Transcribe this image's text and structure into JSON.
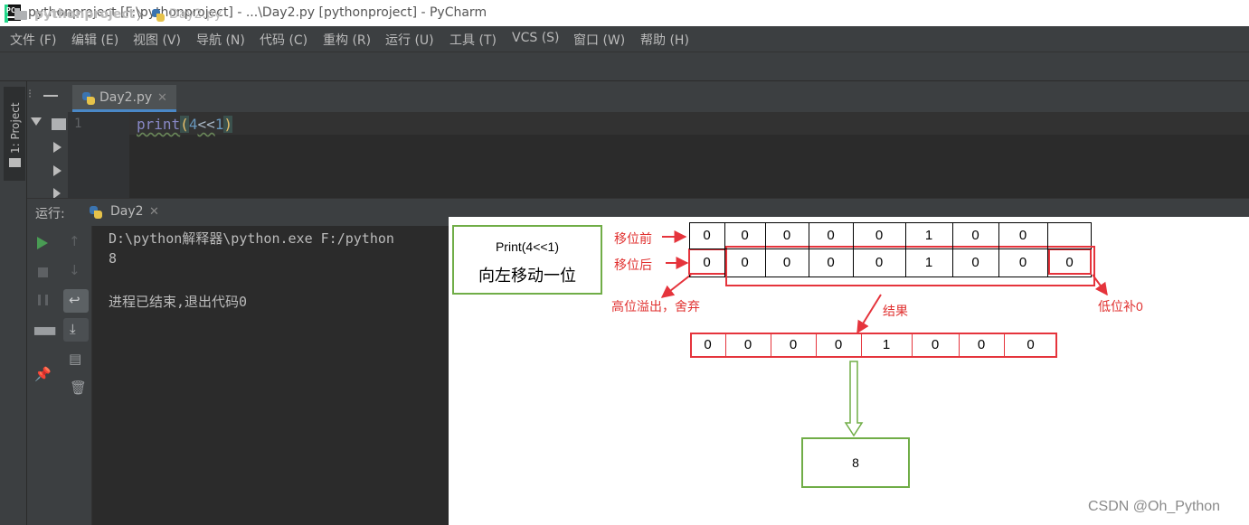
{
  "window": {
    "title": "pythonproject [F:\\pythonproject] - ...\\Day2.py [pythonproject] - PyCharm"
  },
  "menu": [
    "文件 (F)",
    "编辑 (E)",
    "视图 (V)",
    "导航 (N)",
    "代码 (C)",
    "重构 (R)",
    "运行 (U)",
    "工具 (T)",
    "VCS (S)",
    "窗口 (W)",
    "帮助 (H)"
  ],
  "navbar": {
    "project": "pythonproject",
    "separator": "〉",
    "file": "Day2.py"
  },
  "tool_window": {
    "project_tab": "1: Project"
  },
  "editor": {
    "tab_label": "Day2.py",
    "line_number": "1",
    "code": {
      "fn": "print",
      "open": "(",
      "num1": "4",
      "op": "<<",
      "num2": "1",
      "close": ")"
    }
  },
  "run": {
    "label": "运行:",
    "tab_label": "Day2",
    "console": [
      "D:\\python解释器\\python.exe F:/python",
      "8",
      "进程已结束,退出代码0"
    ]
  },
  "diagram": {
    "code_box": {
      "line1": "Print(4<<1)",
      "line2": "向左移动一位"
    },
    "labels": {
      "before": "移位前",
      "after": "移位后",
      "overflow": "高位溢出，舍弃",
      "pad": "低位补0",
      "result": "结果"
    },
    "before_bits": [
      "0",
      "0",
      "0",
      "0",
      "0",
      "1",
      "0",
      "0",
      ""
    ],
    "after_bits": [
      "0",
      "0",
      "0",
      "0",
      "0",
      "1",
      "0",
      "0",
      "0"
    ],
    "result_bits": [
      "0",
      "0",
      "0",
      "0",
      "1",
      "0",
      "0",
      "0"
    ],
    "result_value": "8",
    "watermark": "CSDN @Oh_Python",
    "colors": {
      "red": "#e5343c",
      "green": "#70ad47"
    }
  }
}
